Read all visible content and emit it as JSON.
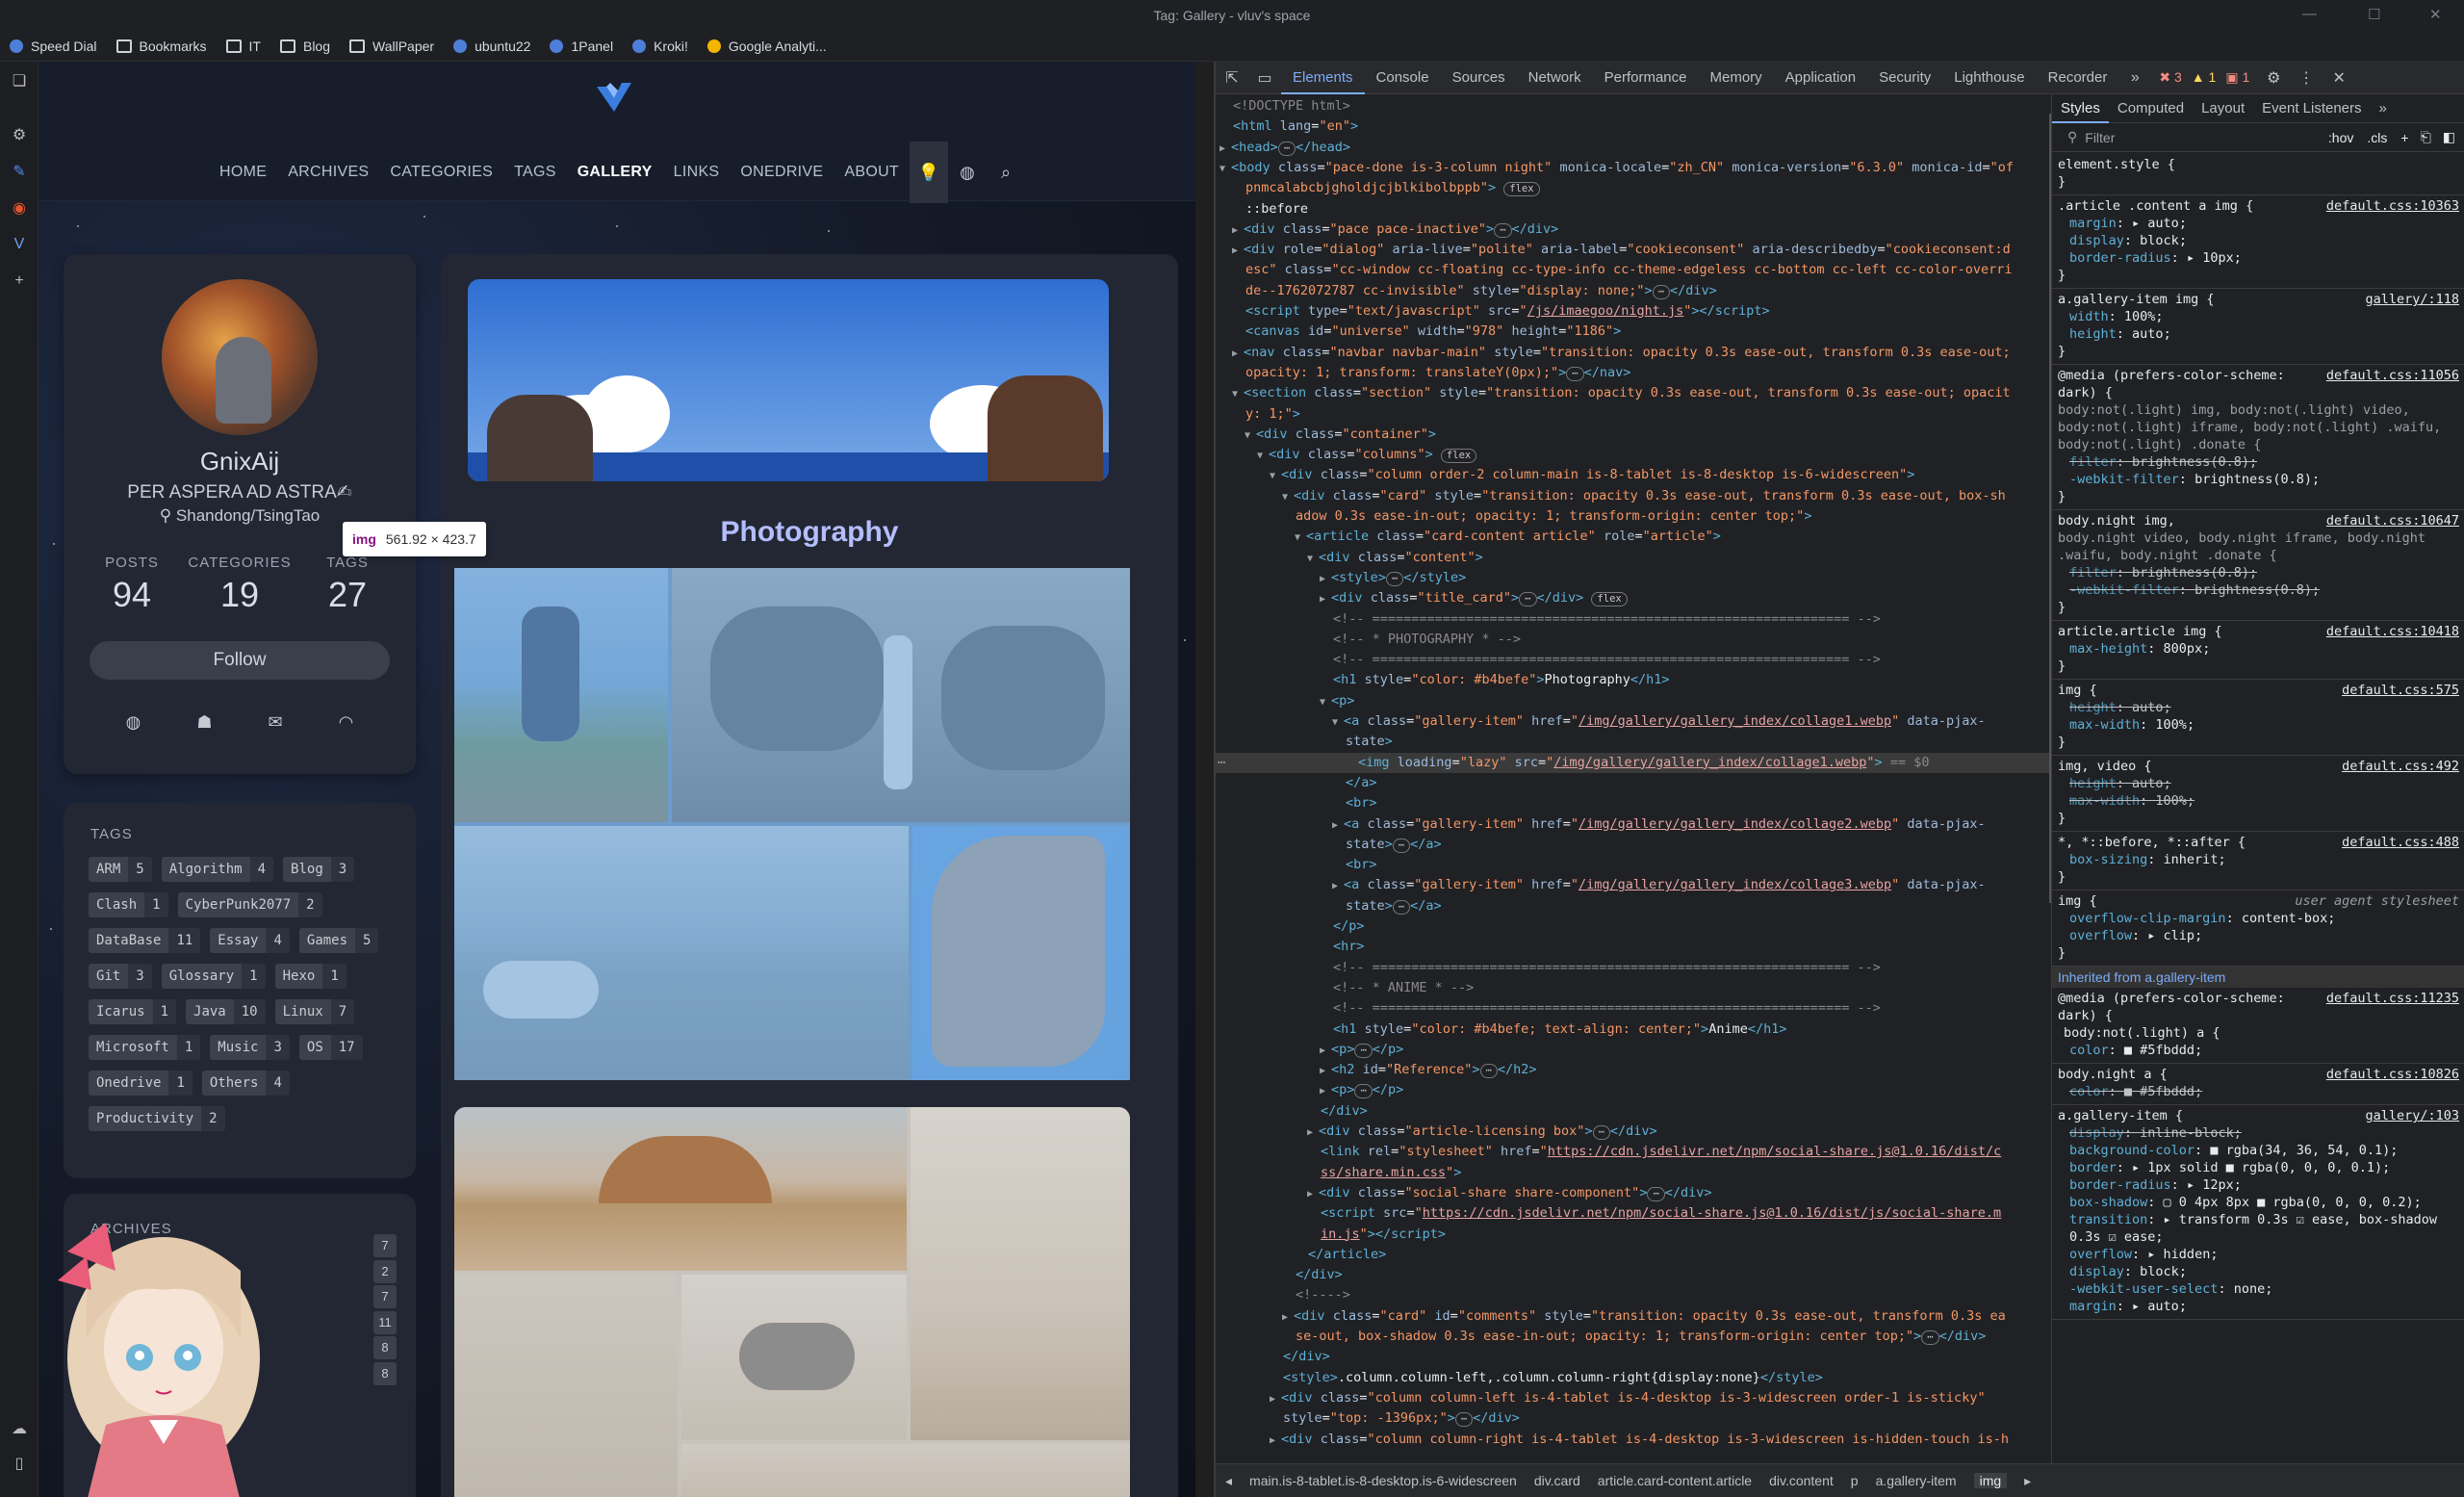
{
  "window": {
    "title": "Tag: Gallery - vluv's space"
  },
  "bookmarks": [
    {
      "label": "Speed Dial",
      "icon": "speed-dial-icon"
    },
    {
      "label": "Bookmarks",
      "icon": "folder-icon"
    },
    {
      "label": "IT",
      "icon": "folder-icon"
    },
    {
      "label": "Blog",
      "icon": "folder-icon"
    },
    {
      "label": "WallPaper",
      "icon": "folder-icon"
    },
    {
      "label": "ubuntu22",
      "icon": "bookmark-icon"
    },
    {
      "label": "1Panel",
      "icon": "bookmark-icon"
    },
    {
      "label": "Kroki!",
      "icon": "bookmark-icon"
    },
    {
      "label": "Google Analyti...",
      "icon": "analytics-icon"
    }
  ],
  "site": {
    "nav": [
      "HOME",
      "ARCHIVES",
      "CATEGORIES",
      "TAGS",
      "GALLERY",
      "LINKS",
      "ONEDRIVE",
      "ABOUT"
    ],
    "active_nav": "GALLERY",
    "profile": {
      "name": "GnixAij",
      "motto": "PER ASPERA AD ASTRA✍",
      "location": "Shandong/TsingTao",
      "stats": [
        {
          "label": "POSTS",
          "value": "94"
        },
        {
          "label": "CATEGORIES",
          "value": "19"
        },
        {
          "label": "TAGS",
          "value": "27"
        }
      ],
      "follow_label": "Follow"
    },
    "tags_heading": "TAGS",
    "tags": [
      {
        "name": "ARM",
        "count": "5"
      },
      {
        "name": "Algorithm",
        "count": "4"
      },
      {
        "name": "Blog",
        "count": "3"
      },
      {
        "name": "Clash",
        "count": "1"
      },
      {
        "name": "CyberPunk2077",
        "count": "2"
      },
      {
        "name": "DataBase",
        "count": "11"
      },
      {
        "name": "Essay",
        "count": "4"
      },
      {
        "name": "Games",
        "count": "5"
      },
      {
        "name": "Git",
        "count": "3"
      },
      {
        "name": "Glossary",
        "count": "1"
      },
      {
        "name": "Hexo",
        "count": "1"
      },
      {
        "name": "Icarus",
        "count": "1"
      },
      {
        "name": "Java",
        "count": "10"
      },
      {
        "name": "Linux",
        "count": "7"
      },
      {
        "name": "Microsoft",
        "count": "1"
      },
      {
        "name": "Music",
        "count": "3"
      },
      {
        "name": "OS",
        "count": "17"
      },
      {
        "name": "Onedrive",
        "count": "1"
      },
      {
        "name": "Others",
        "count": "4"
      },
      {
        "name": "Productivity",
        "count": "2"
      }
    ],
    "archives_heading": "ARCHIVES",
    "archive_counts": [
      "7",
      "2",
      "7",
      "11",
      "8",
      "8"
    ],
    "photo_heading": "Photography",
    "tooltip": {
      "tag": "img",
      "size": "561.92 × 423.7"
    }
  },
  "devtools": {
    "tabs": [
      "Elements",
      "Console",
      "Sources",
      "Network",
      "Performance",
      "Memory",
      "Application",
      "Security",
      "Lighthouse",
      "Recorder"
    ],
    "active_tab": "Elements",
    "issues": {
      "errors": "3",
      "warnings": "1",
      "info": "1"
    },
    "styles_tabs": [
      "Styles",
      "Computed",
      "Layout",
      "Event Listeners"
    ],
    "filter_placeholder": "Filter",
    "hov": ":hov",
    "cls": ".cls",
    "breadcrumbs": [
      "main.is-8-tablet.is-8-desktop.is-6-widescreen",
      "div.card",
      "article.card-content.article",
      "div.content",
      "p",
      "a.gallery-item",
      "img"
    ],
    "inherited_label": "Inherited from",
    "inherited_from": "a.gallery-item"
  }
}
